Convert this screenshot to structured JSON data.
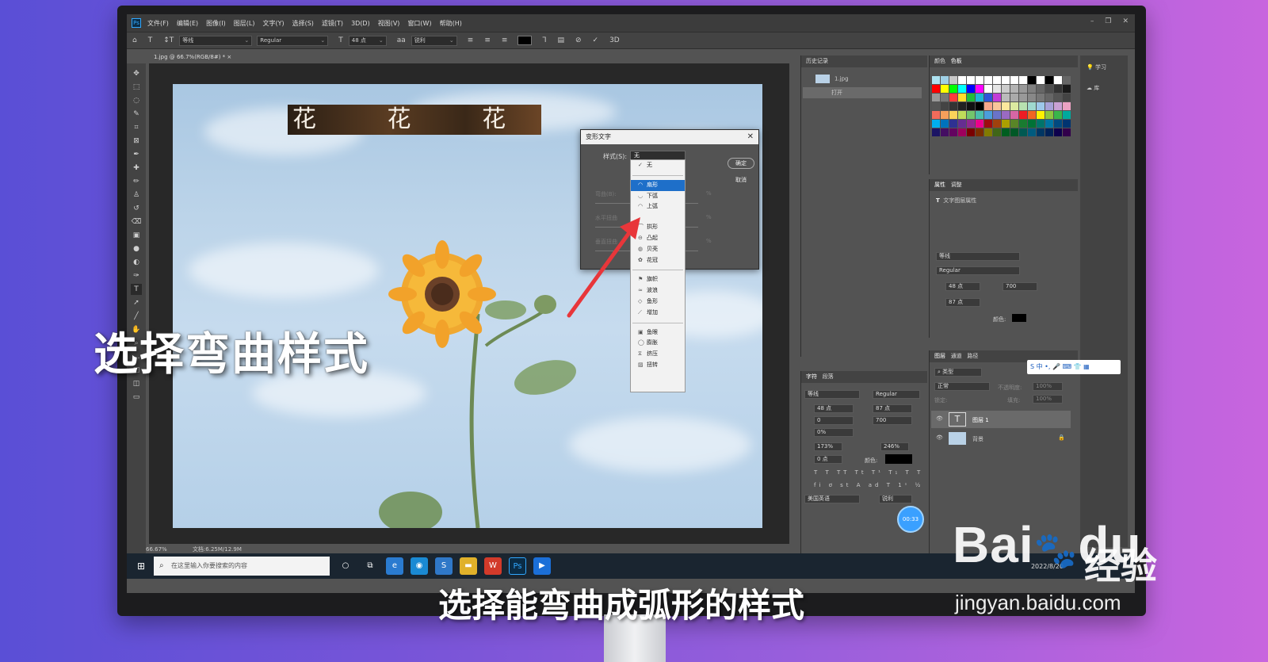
{
  "menubar": {
    "items": [
      "文件(F)",
      "编辑(E)",
      "图像(I)",
      "图层(L)",
      "文字(Y)",
      "选择(S)",
      "滤镜(T)",
      "3D(D)",
      "视图(V)",
      "窗口(W)",
      "帮助(H)"
    ],
    "app_icon": "Ps"
  },
  "options": {
    "font_family": "等线",
    "font_style": "Regular",
    "font_size": "48 点",
    "antialias": "锐利",
    "three_d": "3D"
  },
  "document": {
    "tab_title": "1.jpg @ 66.7%(RGB/8#) *",
    "canvas_text": "花 花 花 花",
    "zoom": "66.67%",
    "doc_size": "文档:6.25M/12.9M"
  },
  "warp_dialog": {
    "title": "变形文字",
    "style_label": "样式(S):",
    "style_value": "无",
    "ok": "确定",
    "cancel": "取消",
    "bend_label": "弯曲(B):",
    "hdist_label": "水平扭曲",
    "vdist_label": "垂直扭曲",
    "pct": "%"
  },
  "warp_menu": {
    "items_group1": [
      "无"
    ],
    "items_group2": [
      "扇形",
      "下弧",
      "上弧"
    ],
    "items_group3": [
      "拱形",
      "凸起",
      "贝壳",
      "花冠"
    ],
    "items_group4": [
      "旗帜",
      "波浪",
      "鱼形",
      "增加"
    ],
    "items_group5": [
      "鱼眼",
      "膨胀",
      "挤压",
      "扭转"
    ],
    "selected": "扇形"
  },
  "history": {
    "tab": "历史记录",
    "snapshot": "1.jpg",
    "step": "打开"
  },
  "colors": {
    "tab1": "颜色",
    "tab2": "色板"
  },
  "properties": {
    "tab1": "属性",
    "tab2": "调整",
    "header": "文字图层属性",
    "font_family": "等线",
    "font_style": "Regular",
    "size": "48 点",
    "tracking": "700",
    "leading": "87 点",
    "color_label": "颜色:"
  },
  "character": {
    "tab1": "字符",
    "tab2": "段落",
    "font_family": "等线",
    "font_style": "Regular",
    "size": "48 点",
    "leading": "87 点",
    "kerning": "0",
    "tracking": "700",
    "scale_pct": "0%",
    "vscale": "173%",
    "hscale": "246%",
    "baseline": "0 点",
    "color_label": "颜色:",
    "language": "美国英语",
    "aa": "锐利"
  },
  "layers": {
    "tab1": "图层",
    "tab2": "通道",
    "tab3": "路径",
    "kind": "类型",
    "blend": "正常",
    "opacity_label": "不透明度:",
    "opacity": "100%",
    "lock_label": "锁定:",
    "fill_label": "填充:",
    "fill": "100%",
    "items": [
      "图层 1",
      "背景"
    ]
  },
  "learn": {
    "label": "学习",
    "lib": "库"
  },
  "taskbar": {
    "search_placeholder": "在这里输入你要搜索的内容",
    "ime": "中",
    "date": "2022/8/20"
  },
  "timer": "00:33",
  "overlay_title": "选择弯曲样式",
  "caption": "选择能弯曲成弧形的样式",
  "watermark": {
    "brand": "Bai",
    "brand2": "du",
    "cn": "经验",
    "url": "jingyan.baidu.com"
  },
  "colors_theme": {
    "ps_accent": "#31a8ff",
    "selection": "#1e6fc9",
    "arrow": "#e8363a"
  }
}
